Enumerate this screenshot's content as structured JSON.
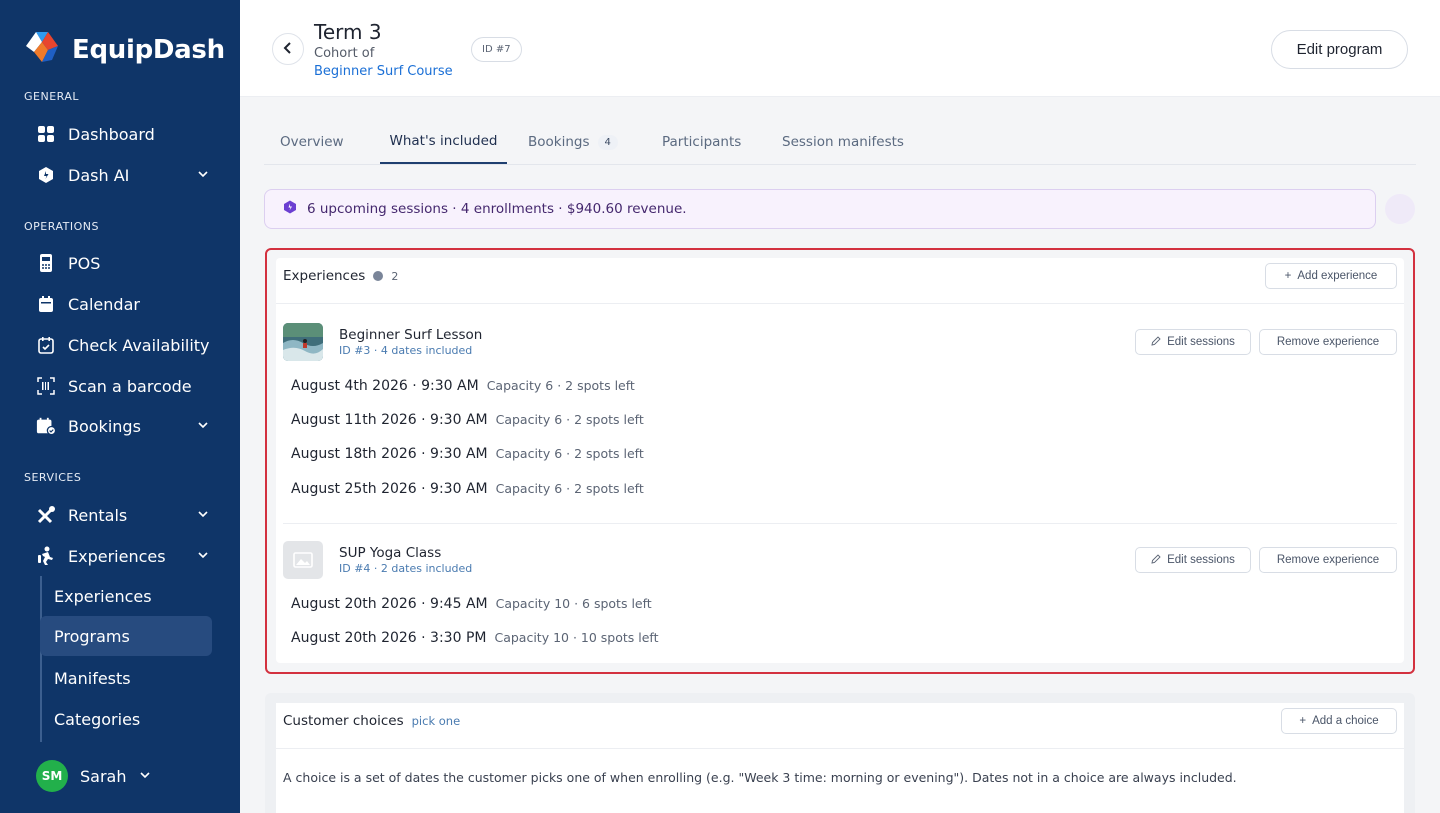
{
  "sidebar": {
    "brand": "EquipDash",
    "sections": {
      "general": "GENERAL",
      "operations": "OPERATIONS",
      "services": "SERVICES"
    },
    "items": {
      "dashboard": "Dashboard",
      "dash_ai": "Dash AI",
      "pos": "POS",
      "calendar": "Calendar",
      "check_availability": "Check Availability",
      "scan_barcode": "Scan a barcode",
      "bookings": "Bookings",
      "rentals": "Rentals",
      "experiences": "Experiences"
    },
    "sub_items": {
      "experiences": "Experiences",
      "programs": "Programs",
      "manifests": "Manifests",
      "categories": "Categories"
    },
    "user": {
      "initials": "SM",
      "name": "Sarah"
    }
  },
  "header": {
    "title": "Term 3",
    "cohort_prefix": "Cohort of",
    "cohort_link": "Beginner Surf Course",
    "id_badge": "ID #7",
    "edit_button": "Edit program"
  },
  "tabs": {
    "overview": "Overview",
    "whats_included": "What's included",
    "bookings": "Bookings",
    "bookings_count": "4",
    "participants": "Participants",
    "session_manifests": "Session manifests"
  },
  "banner": {
    "text": "6 upcoming sessions · 4 enrollments · $940.60 revenue."
  },
  "experiences_panel": {
    "title": "Experiences",
    "count": "2",
    "add_button": "Add experience",
    "edit_sessions": "Edit sessions",
    "remove_experience": "Remove experience",
    "items": [
      {
        "name": "Beginner Surf Lesson",
        "meta": "ID #3 · 4 dates included",
        "dates": [
          {
            "date": "August 4th 2026 · 9:30 AM",
            "capacity": "Capacity 6 · 2 spots left"
          },
          {
            "date": "August 11th 2026 · 9:30 AM",
            "capacity": "Capacity 6 · 2 spots left"
          },
          {
            "date": "August 18th 2026 · 9:30 AM",
            "capacity": "Capacity 6 · 2 spots left"
          },
          {
            "date": "August 25th 2026 · 9:30 AM",
            "capacity": "Capacity 6 · 2 spots left"
          }
        ]
      },
      {
        "name": "SUP Yoga Class",
        "meta": "ID #4 · 2 dates included",
        "dates": [
          {
            "date": "August 20th 2026 · 9:45 AM",
            "capacity": "Capacity 10 · 6 spots left"
          },
          {
            "date": "August 20th 2026 · 3:30 PM",
            "capacity": "Capacity 10 · 10 spots left"
          }
        ]
      }
    ]
  },
  "choices_panel": {
    "title": "Customer choices",
    "subtitle": "pick one",
    "add_button": "Add a choice",
    "description": "A choice is a set of dates the customer picks one of when enrolling (e.g. \"Week 3 time: morning or evening\"). Dates not in a choice are always included."
  },
  "colors": {
    "sidebar_bg": "#0f3568",
    "accent_link": "#1a6fd6",
    "highlight": "#d3313f",
    "banner_bg": "#f8f2fd"
  }
}
